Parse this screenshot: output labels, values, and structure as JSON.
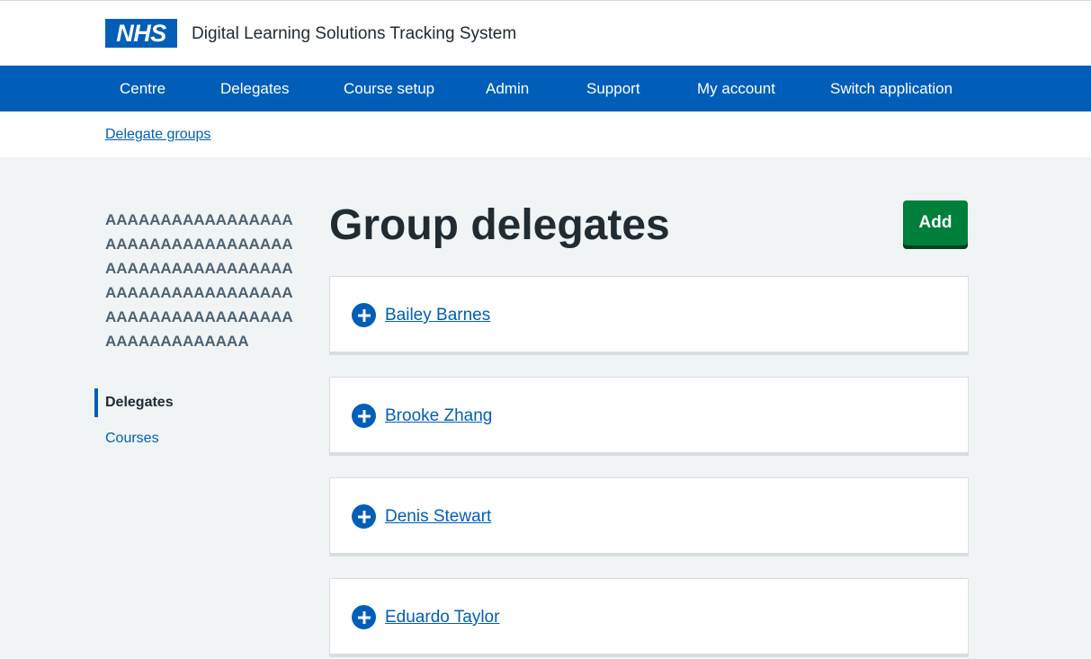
{
  "header": {
    "logo_text": "NHS",
    "service_name": "Digital Learning Solutions Tracking System"
  },
  "nav": {
    "items": [
      {
        "label": "Centre"
      },
      {
        "label": "Delegates"
      },
      {
        "label": "Course setup"
      },
      {
        "label": "Admin"
      },
      {
        "label": "Support"
      },
      {
        "label": "My account"
      },
      {
        "label": "Switch application"
      }
    ]
  },
  "breadcrumb": {
    "link": "Delegate groups"
  },
  "sidebar": {
    "group_name": "AAAAAAAAAAAAAAAAAAAAAAAAAAAAAAAAAAAAAAAAAAAAAAAAAAAAAAAAAAAAAAAAAAAAAAAAAAAAAAAAAAAAAAAAAAAAAAAAAA",
    "items": [
      {
        "label": "Delegates",
        "active": true
      },
      {
        "label": "Courses",
        "active": false
      }
    ]
  },
  "main": {
    "title": "Group delegates",
    "add_label": "Add",
    "delegates": [
      {
        "name": "Bailey Barnes"
      },
      {
        "name": "Brooke Zhang"
      },
      {
        "name": "Denis Stewart"
      },
      {
        "name": "Eduardo Taylor"
      }
    ]
  },
  "colors": {
    "nhs_blue": "#005eb8",
    "button_green": "#007f3b",
    "page_background": "#f0f4f5",
    "text_dark": "#212b32",
    "text_secondary": "#4c6272"
  }
}
